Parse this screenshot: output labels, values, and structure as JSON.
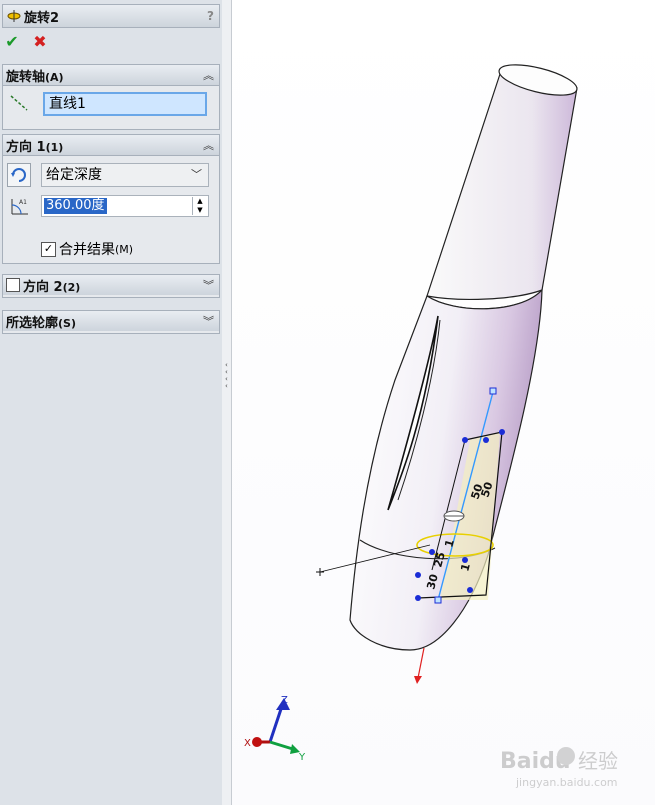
{
  "panel": {
    "title": "旋转2",
    "help": "?",
    "ok_symbol": "✔",
    "cancel_symbol": "✖"
  },
  "axis_group": {
    "title": "旋转轴",
    "title_suffix": "(A)",
    "selection": "直线1"
  },
  "direction1": {
    "title": "方向 1",
    "title_suffix": "(1)",
    "end_condition": "给定深度",
    "angle_value": "360.00度",
    "merge_label": "合并结果",
    "merge_suffix": "(M)",
    "merge_checked": true
  },
  "direction2": {
    "title": "方向 2",
    "title_suffix": "(2)",
    "checked": false
  },
  "contours": {
    "title": "所选轮廓",
    "title_suffix": "(S)"
  },
  "triad": {
    "x": "X",
    "y": "Y",
    "z": "Z"
  },
  "dimensions": [
    "25",
    "30",
    "1",
    "1",
    "50",
    "50"
  ],
  "watermark": {
    "brand": "Baidu",
    "brand_cn": "经验",
    "url": "jingyan.baidu.com"
  },
  "colors": {
    "ok": "#1b9a2a",
    "cancel": "#d42020",
    "selection": "#2a67c7",
    "sketch": "#1a2cd6"
  }
}
